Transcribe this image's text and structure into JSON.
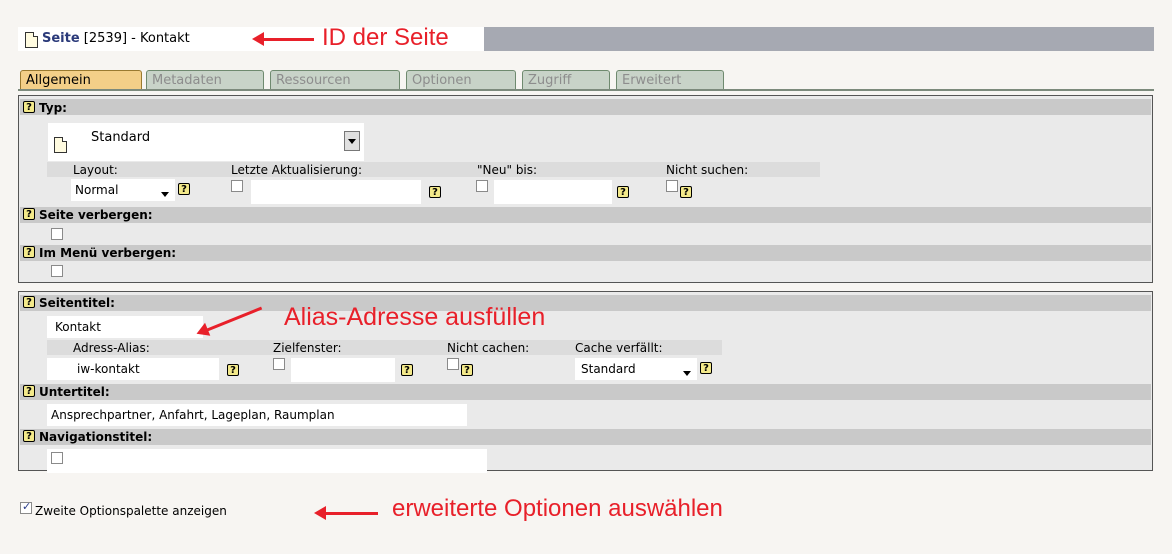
{
  "header": {
    "link": "Seite",
    "title_rest": " [2539] - Kontakt",
    "annotation": "ID der Seite"
  },
  "tabs": [
    "Allgemein",
    "Metadaten",
    "Ressourcen",
    "Optionen",
    "Zugriff",
    "Erweitert"
  ],
  "panel1": {
    "help": "?",
    "typ_label": "Typ:",
    "typ_value": "Standard",
    "layout_label": "Layout:",
    "layout_value": "Normal",
    "letzte_label": "Letzte Aktualisierung:",
    "neu_label": "\"Neu\" bis:",
    "nicht_suchen_label": "Nicht suchen:",
    "seite_verbergen_label": "Seite verbergen:",
    "menu_verbergen_label": "Im Menü verbergen:"
  },
  "panel2": {
    "seitentitel_label": "Seitentitel:",
    "seitentitel_value": "Kontakt",
    "alias_label": "Adress-Alias:",
    "alias_value": "iw-kontakt",
    "zielfenster_label": "Zielfenster:",
    "nicht_cachen_label": "Nicht cachen:",
    "cache_label": "Cache verfällt:",
    "cache_value": "Standard",
    "untertitel_label": "Untertitel:",
    "untertitel_value": "Ansprechpartner, Anfahrt, Lageplan, Raumplan",
    "navtitel_label": "Navigationstitel:",
    "alias_annotation": "Alias-Adresse ausfüllen"
  },
  "footer": {
    "checkbox_label": "Zweite Optionspalette anzeigen",
    "annotation": "erweiterte Optionen auswählen"
  },
  "colors": {
    "annotation": "#e8202a",
    "active_tab": "#f3cf88",
    "inactive_tab": "#c8d3c8",
    "header_bar": "#a6a9b2"
  }
}
